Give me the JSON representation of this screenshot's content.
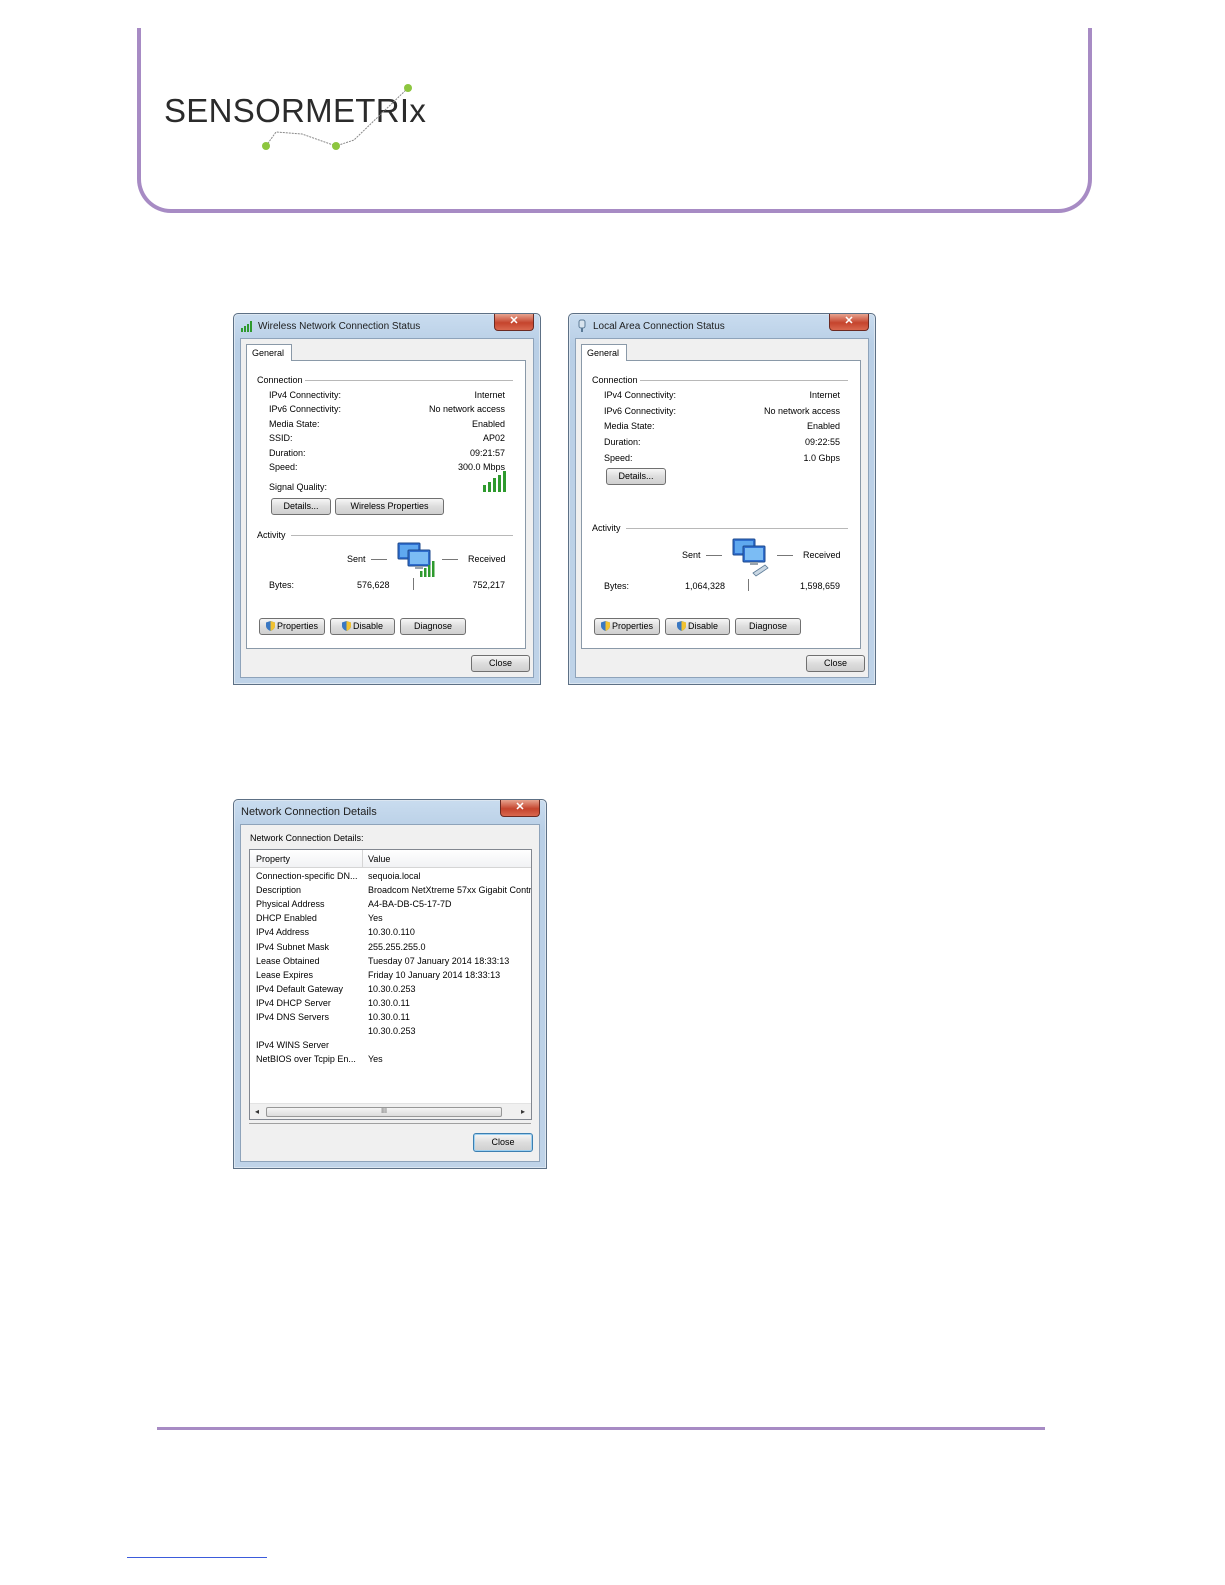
{
  "brand": {
    "logo_text": "SENSORMETRIx",
    "accent_color": "#a78bc4",
    "dot_color": "#8dc63f"
  },
  "wireless": {
    "title": "Wireless Network Connection Status",
    "icon": "signal-bars-icon",
    "tab": "General",
    "connection_label": "Connection",
    "rows": [
      {
        "label": "IPv4 Connectivity:",
        "value": "Internet"
      },
      {
        "label": "IPv6 Connectivity:",
        "value": "No network access"
      },
      {
        "label": "Media State:",
        "value": "Enabled"
      },
      {
        "label": "SSID:",
        "value": "AP02"
      },
      {
        "label": "Duration:",
        "value": "09:21:57"
      },
      {
        "label": "Speed:",
        "value": "300.0 Mbps"
      }
    ],
    "signal_label": "Signal Quality:",
    "details_btn": "Details...",
    "wireless_props_btn": "Wireless Properties",
    "activity_label": "Activity",
    "sent_label": "Sent",
    "received_label": "Received",
    "bytes_label": "Bytes:",
    "bytes_sent": "576,628",
    "bytes_received": "752,217",
    "properties_btn": "Properties",
    "disable_btn": "Disable",
    "diagnose_btn": "Diagnose",
    "close_btn": "Close"
  },
  "lan": {
    "title": "Local Area Connection Status",
    "icon": "ethernet-plug-icon",
    "tab": "General",
    "connection_label": "Connection",
    "rows": [
      {
        "label": "IPv4 Connectivity:",
        "value": "Internet"
      },
      {
        "label": "IPv6 Connectivity:",
        "value": "No network access"
      },
      {
        "label": "Media State:",
        "value": "Enabled"
      },
      {
        "label": "Duration:",
        "value": "09:22:55"
      },
      {
        "label": "Speed:",
        "value": "1.0 Gbps"
      }
    ],
    "details_btn": "Details...",
    "activity_label": "Activity",
    "sent_label": "Sent",
    "received_label": "Received",
    "bytes_label": "Bytes:",
    "bytes_sent": "1,064,328",
    "bytes_received": "1,598,659",
    "properties_btn": "Properties",
    "disable_btn": "Disable",
    "diagnose_btn": "Diagnose",
    "close_btn": "Close"
  },
  "details": {
    "title": "Network Connection Details",
    "section_label": "Network Connection Details:",
    "col_property": "Property",
    "col_value": "Value",
    "rows": [
      {
        "property": "Connection-specific DN...",
        "value": "sequoia.local"
      },
      {
        "property": "Description",
        "value": "Broadcom NetXtreme 57xx Gigabit Contro"
      },
      {
        "property": "Physical Address",
        "value": "A4-BA-DB-C5-17-7D"
      },
      {
        "property": "DHCP Enabled",
        "value": "Yes"
      },
      {
        "property": "IPv4 Address",
        "value": "10.30.0.110"
      },
      {
        "property": "IPv4 Subnet Mask",
        "value": "255.255.255.0"
      },
      {
        "property": "Lease Obtained",
        "value": "Tuesday 07 January 2014 18:33:13"
      },
      {
        "property": "Lease Expires",
        "value": "Friday 10 January 2014 18:33:13"
      },
      {
        "property": "IPv4 Default Gateway",
        "value": "10.30.0.253"
      },
      {
        "property": "IPv4 DHCP Server",
        "value": "10.30.0.11"
      },
      {
        "property": "IPv4 DNS Servers",
        "value": "10.30.0.11"
      },
      {
        "property": "",
        "value": "10.30.0.253"
      },
      {
        "property": "IPv4 WINS Server",
        "value": ""
      },
      {
        "property": "NetBIOS over Tcpip En...",
        "value": "Yes"
      }
    ],
    "scroll_thumb": "III",
    "close_btn": "Close"
  }
}
